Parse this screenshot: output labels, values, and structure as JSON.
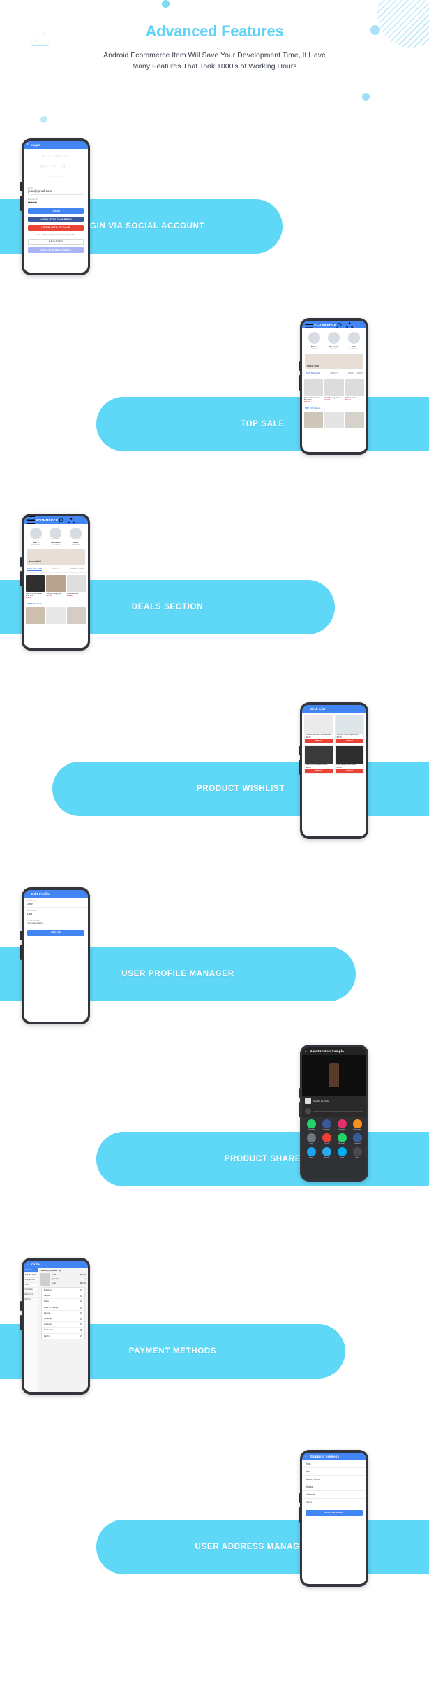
{
  "header": {
    "title": "Advanced Features",
    "subtitle_line1": "Android Ecommerce Item Will Save Your Development Time, It Have",
    "subtitle_line2": "Many Features That Took 1000's of Working Hours"
  },
  "colors": {
    "accent_banner": "#5FD7F7",
    "title": "#5FD2F7",
    "appbar_blue": "#4285F4",
    "facebook": "#3B5998",
    "google_red": "#EA4335",
    "guest": "#AAB4F8",
    "phone_frame": "#32363C",
    "subtitle_text": "#3D4450"
  },
  "features": [
    {
      "id": "login-social",
      "label": "LOGIN VIA SOCIAL ACCOUNT",
      "side": "right"
    },
    {
      "id": "top-sale",
      "label": "TOP SALE",
      "side": "left"
    },
    {
      "id": "deals-section",
      "label": "DEALS SECTION",
      "side": "right"
    },
    {
      "id": "product-wishlist",
      "label": "PRODUCT WISHLIST",
      "side": "left"
    },
    {
      "id": "user-profile",
      "label": "USER PROFILE MANAGER",
      "side": "right"
    },
    {
      "id": "product-share",
      "label": "PRODUCT SHARE",
      "side": "left"
    },
    {
      "id": "payment-methods",
      "label": "PAYMENT METHODS",
      "side": "right"
    },
    {
      "id": "user-address",
      "label": "USER ADDRESS MANAGEMENT",
      "side": "left"
    }
  ],
  "login_screen": {
    "appbar_title": "Login",
    "close_icon": "close-icon",
    "email_label": "Email",
    "email_value": "jhon@gmail.com",
    "password_label": "Password",
    "password_value": "••••••••",
    "btn_login": "LOGIN",
    "btn_facebook": "LOGIN WITH FACEBOOK",
    "btn_google": "LOGIN WITH GOOGLE",
    "forgot": "I'VE FORGOTTEN MY PASSWORD",
    "btn_register": "REGISTER",
    "btn_guest": "CONTINUE AS A GUEST"
  },
  "shop_screen": {
    "logo": "ECOMMERCE",
    "menu_icon": "hamburger-icon",
    "search_icon": "search-icon",
    "cart_icon": "cart-icon",
    "categories": [
      {
        "name": "Men's",
        "sub": "10 Products"
      },
      {
        "name": "Women's",
        "sub": "12 Products"
      },
      {
        "name": "Kid's",
        "sub": "8 Products"
      }
    ],
    "promo_label": "House Hold",
    "tabs": [
      {
        "label": "TOP SELLER",
        "active": true
      },
      {
        "label": "DEALS",
        "active": false
      },
      {
        "label": "MOST LIKED",
        "active": false
      }
    ],
    "products": [
      {
        "name": "Men's Cotton Classic Blue Shirt",
        "price": "$25.00"
      },
      {
        "name": "Straight Long Coat",
        "price": "$47.00"
      },
      {
        "name": "Surface Jacket",
        "price": "$59.00"
      }
    ],
    "section_title": "TOP 3 Products"
  },
  "deals_screen": {
    "logo": "ECOMMERCE",
    "tabs": [
      {
        "label": "TOP SELLER",
        "active": false
      },
      {
        "label": "DEALS",
        "active": true
      },
      {
        "label": "MOST LIKED",
        "active": false
      }
    ],
    "products": [
      {
        "name": "Men's Cotton Classic Blue Shirt",
        "price": "$25.00"
      },
      {
        "name": "Straight Long Coat",
        "price": "$47.00"
      },
      {
        "name": "Surface Jacket",
        "price": "$59.00"
      }
    ],
    "section_title": "TOP 3 Products",
    "promo_label": "House Hold",
    "categories": [
      {
        "name": "Men's",
        "sub": "10 Products"
      },
      {
        "name": "Women's",
        "sub": "12 Products"
      },
      {
        "name": "Kid's",
        "sub": "8 Products"
      }
    ]
  },
  "wishlist_screen": {
    "appbar_title": "Wish List",
    "back_icon": "back-arrow-icon",
    "items": [
      {
        "name": "Black Knitted Mesh Casual Shoes",
        "price": "$45.00",
        "action": "REMOVE"
      },
      {
        "name": "Juventus Home Replica Shirt",
        "price": "$65.00",
        "action": "REMOVE"
      },
      {
        "name": "Men's Cotton Classic Bundle",
        "price": "$25.00",
        "action": "REMOVE"
      },
      {
        "name": "Alloy Military Quartz Watch",
        "price": "$35.00",
        "action": "REMOVE"
      }
    ]
  },
  "profile_screen": {
    "appbar_title": "Edit Profile",
    "back_icon": "back-arrow-icon",
    "fields": [
      {
        "label": "First Name",
        "value": "Jhon"
      },
      {
        "label": "Last Name",
        "value": "Doe"
      },
      {
        "label": "Phone Number",
        "value": "1234567891"
      }
    ],
    "update_btn": "UPDATE"
  },
  "share_screen": {
    "appbar_title": "New Pro Fan Sample",
    "item_text": "See Pro Ice Circle",
    "apps_row1": [
      {
        "name": "WhatsApp",
        "color": "#25D366"
      },
      {
        "name": "Facebook",
        "color": "#3B5998"
      },
      {
        "name": "Instagram",
        "color": "#E1306C"
      },
      {
        "name": "Messenger",
        "color": "#F7931E"
      }
    ],
    "apps_row2": [
      {
        "name": "Copy",
        "color": "#6E7880"
      },
      {
        "name": "Gmail",
        "color": "#EA4335"
      },
      {
        "name": "WhatsApp",
        "color": "#25D366"
      },
      {
        "name": "Facebook",
        "color": "#3B5998"
      }
    ],
    "apps_row3": [
      {
        "name": "Twitter",
        "color": "#1DA1F2"
      },
      {
        "name": "Telegram",
        "color": "#2AABEE"
      },
      {
        "name": "Skype",
        "color": "#00AFF0"
      },
      {
        "name": "More",
        "color": "#4A4A4A"
      }
    ]
  },
  "payment_screen": {
    "appbar_title": "Order",
    "rail_items": [
      {
        "label": "Cart Total",
        "active": true
      },
      {
        "label": "Shipment Detail",
        "active": false
      },
      {
        "label": "Shipping Cost",
        "active": false
      },
      {
        "label": "Total",
        "active": false
      },
      {
        "label": "Order Notes",
        "active": false
      },
      {
        "label": "Back to Cart",
        "active": false
      },
      {
        "label": "Payment",
        "active": false
      }
    ],
    "section_title": "Button @ Shoulder Top",
    "summary": [
      {
        "label": "Price",
        "value": "$60.00"
      },
      {
        "label": "Quantity",
        "value": "1"
      },
      {
        "label": "Total",
        "value": "$60.00"
      }
    ],
    "methods": [
      "Braintree",
      "Paypal",
      "Stripe",
      "Cash on Delivery",
      "Paypal",
      "Instamojo",
      "Hyperpay",
      "Razor Pay",
      "PayTm"
    ]
  },
  "address_screen": {
    "appbar_title": "Shipping Address",
    "back_icon": "back-arrow-icon",
    "fields": [
      "Jhon",
      "doe",
      "doctors street",
      "Alaska",
      "california",
      "90210"
    ],
    "save_btn": "SAVE ADDRESS"
  }
}
